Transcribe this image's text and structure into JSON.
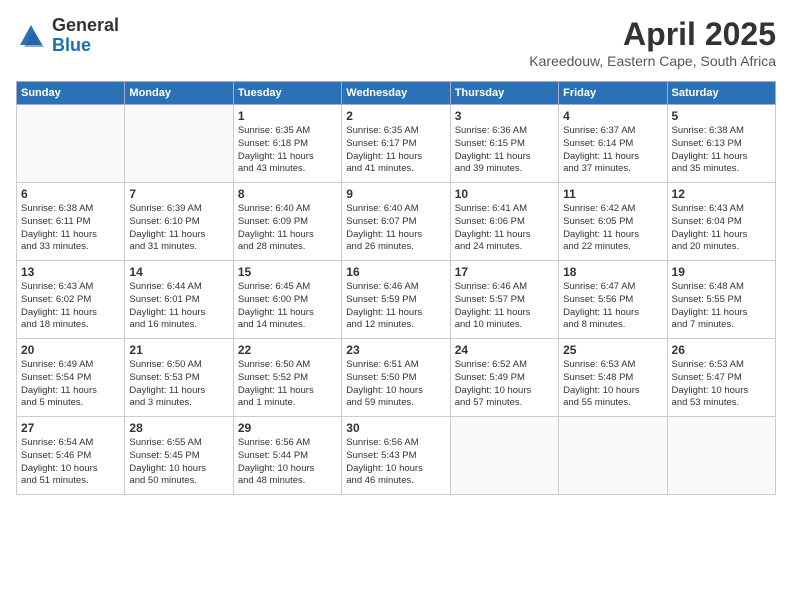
{
  "header": {
    "logo_general": "General",
    "logo_blue": "Blue",
    "month_title": "April 2025",
    "location": "Kareedouw, Eastern Cape, South Africa"
  },
  "calendar": {
    "days_of_week": [
      "Sunday",
      "Monday",
      "Tuesday",
      "Wednesday",
      "Thursday",
      "Friday",
      "Saturday"
    ],
    "weeks": [
      [
        {
          "day": "",
          "info": ""
        },
        {
          "day": "",
          "info": ""
        },
        {
          "day": "1",
          "info": "Sunrise: 6:35 AM\nSunset: 6:18 PM\nDaylight: 11 hours\nand 43 minutes."
        },
        {
          "day": "2",
          "info": "Sunrise: 6:35 AM\nSunset: 6:17 PM\nDaylight: 11 hours\nand 41 minutes."
        },
        {
          "day": "3",
          "info": "Sunrise: 6:36 AM\nSunset: 6:15 PM\nDaylight: 11 hours\nand 39 minutes."
        },
        {
          "day": "4",
          "info": "Sunrise: 6:37 AM\nSunset: 6:14 PM\nDaylight: 11 hours\nand 37 minutes."
        },
        {
          "day": "5",
          "info": "Sunrise: 6:38 AM\nSunset: 6:13 PM\nDaylight: 11 hours\nand 35 minutes."
        }
      ],
      [
        {
          "day": "6",
          "info": "Sunrise: 6:38 AM\nSunset: 6:11 PM\nDaylight: 11 hours\nand 33 minutes."
        },
        {
          "day": "7",
          "info": "Sunrise: 6:39 AM\nSunset: 6:10 PM\nDaylight: 11 hours\nand 31 minutes."
        },
        {
          "day": "8",
          "info": "Sunrise: 6:40 AM\nSunset: 6:09 PM\nDaylight: 11 hours\nand 28 minutes."
        },
        {
          "day": "9",
          "info": "Sunrise: 6:40 AM\nSunset: 6:07 PM\nDaylight: 11 hours\nand 26 minutes."
        },
        {
          "day": "10",
          "info": "Sunrise: 6:41 AM\nSunset: 6:06 PM\nDaylight: 11 hours\nand 24 minutes."
        },
        {
          "day": "11",
          "info": "Sunrise: 6:42 AM\nSunset: 6:05 PM\nDaylight: 11 hours\nand 22 minutes."
        },
        {
          "day": "12",
          "info": "Sunrise: 6:43 AM\nSunset: 6:04 PM\nDaylight: 11 hours\nand 20 minutes."
        }
      ],
      [
        {
          "day": "13",
          "info": "Sunrise: 6:43 AM\nSunset: 6:02 PM\nDaylight: 11 hours\nand 18 minutes."
        },
        {
          "day": "14",
          "info": "Sunrise: 6:44 AM\nSunset: 6:01 PM\nDaylight: 11 hours\nand 16 minutes."
        },
        {
          "day": "15",
          "info": "Sunrise: 6:45 AM\nSunset: 6:00 PM\nDaylight: 11 hours\nand 14 minutes."
        },
        {
          "day": "16",
          "info": "Sunrise: 6:46 AM\nSunset: 5:59 PM\nDaylight: 11 hours\nand 12 minutes."
        },
        {
          "day": "17",
          "info": "Sunrise: 6:46 AM\nSunset: 5:57 PM\nDaylight: 11 hours\nand 10 minutes."
        },
        {
          "day": "18",
          "info": "Sunrise: 6:47 AM\nSunset: 5:56 PM\nDaylight: 11 hours\nand 8 minutes."
        },
        {
          "day": "19",
          "info": "Sunrise: 6:48 AM\nSunset: 5:55 PM\nDaylight: 11 hours\nand 7 minutes."
        }
      ],
      [
        {
          "day": "20",
          "info": "Sunrise: 6:49 AM\nSunset: 5:54 PM\nDaylight: 11 hours\nand 5 minutes."
        },
        {
          "day": "21",
          "info": "Sunrise: 6:50 AM\nSunset: 5:53 PM\nDaylight: 11 hours\nand 3 minutes."
        },
        {
          "day": "22",
          "info": "Sunrise: 6:50 AM\nSunset: 5:52 PM\nDaylight: 11 hours\nand 1 minute."
        },
        {
          "day": "23",
          "info": "Sunrise: 6:51 AM\nSunset: 5:50 PM\nDaylight: 10 hours\nand 59 minutes."
        },
        {
          "day": "24",
          "info": "Sunrise: 6:52 AM\nSunset: 5:49 PM\nDaylight: 10 hours\nand 57 minutes."
        },
        {
          "day": "25",
          "info": "Sunrise: 6:53 AM\nSunset: 5:48 PM\nDaylight: 10 hours\nand 55 minutes."
        },
        {
          "day": "26",
          "info": "Sunrise: 6:53 AM\nSunset: 5:47 PM\nDaylight: 10 hours\nand 53 minutes."
        }
      ],
      [
        {
          "day": "27",
          "info": "Sunrise: 6:54 AM\nSunset: 5:46 PM\nDaylight: 10 hours\nand 51 minutes."
        },
        {
          "day": "28",
          "info": "Sunrise: 6:55 AM\nSunset: 5:45 PM\nDaylight: 10 hours\nand 50 minutes."
        },
        {
          "day": "29",
          "info": "Sunrise: 6:56 AM\nSunset: 5:44 PM\nDaylight: 10 hours\nand 48 minutes."
        },
        {
          "day": "30",
          "info": "Sunrise: 6:56 AM\nSunset: 5:43 PM\nDaylight: 10 hours\nand 46 minutes."
        },
        {
          "day": "",
          "info": ""
        },
        {
          "day": "",
          "info": ""
        },
        {
          "day": "",
          "info": ""
        }
      ]
    ]
  }
}
